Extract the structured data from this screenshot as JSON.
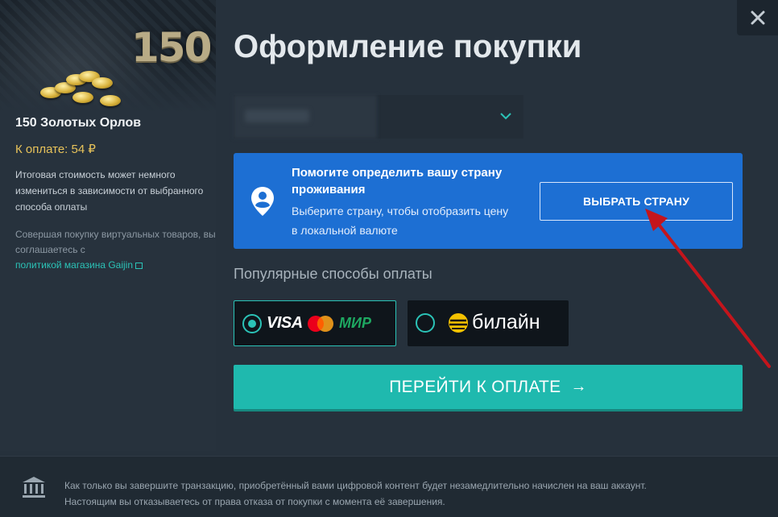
{
  "product": {
    "hero_number": "150",
    "name": "150 Золотых Орлов",
    "price_label": "К оплате: 54 ₽",
    "note_price": "Итоговая стоимость может немного измениться в зависимости от выбранного способа оплаты",
    "note_terms_prefix": "Совершая покупку виртуальных товаров, вы соглашаетесь с",
    "policy_link": "политикой магазина Gaijin"
  },
  "header": {
    "title": "Оформление покупки"
  },
  "country_banner": {
    "title": "Помогите определить вашу страну проживания",
    "description": "Выберите страну, чтобы отобразить цену в локальной валюте",
    "button": "ВЫБРАТЬ СТРАНУ"
  },
  "payment": {
    "section_title": "Популярные способы оплаты",
    "methods": [
      {
        "logo_text": "VISA",
        "extra": "МИР",
        "selected": true
      },
      {
        "logo_text": "билайн",
        "selected": false
      }
    ],
    "proceed_button": "ПЕРЕЙТИ К ОПЛАТЕ"
  },
  "footer": {
    "line1": "Как только вы завершите транзакцию, приобретённый вами цифровой контент будет незамедлительно начислен на ваш аккаунт.",
    "line2": "Настоящим вы отказываетесь от права отказа от покупки с момента её завершения."
  },
  "colors": {
    "accent": "#1fb9ae",
    "banner": "#1d6fd3",
    "price": "#e8c35a",
    "annotation_arrow": "#c4151c"
  },
  "icons": [
    "close-icon",
    "chevron-down-icon",
    "location-person-icon",
    "mastercard-icon",
    "beeline-icon",
    "arrow-right-icon",
    "bank-icon",
    "external-link-icon"
  ]
}
